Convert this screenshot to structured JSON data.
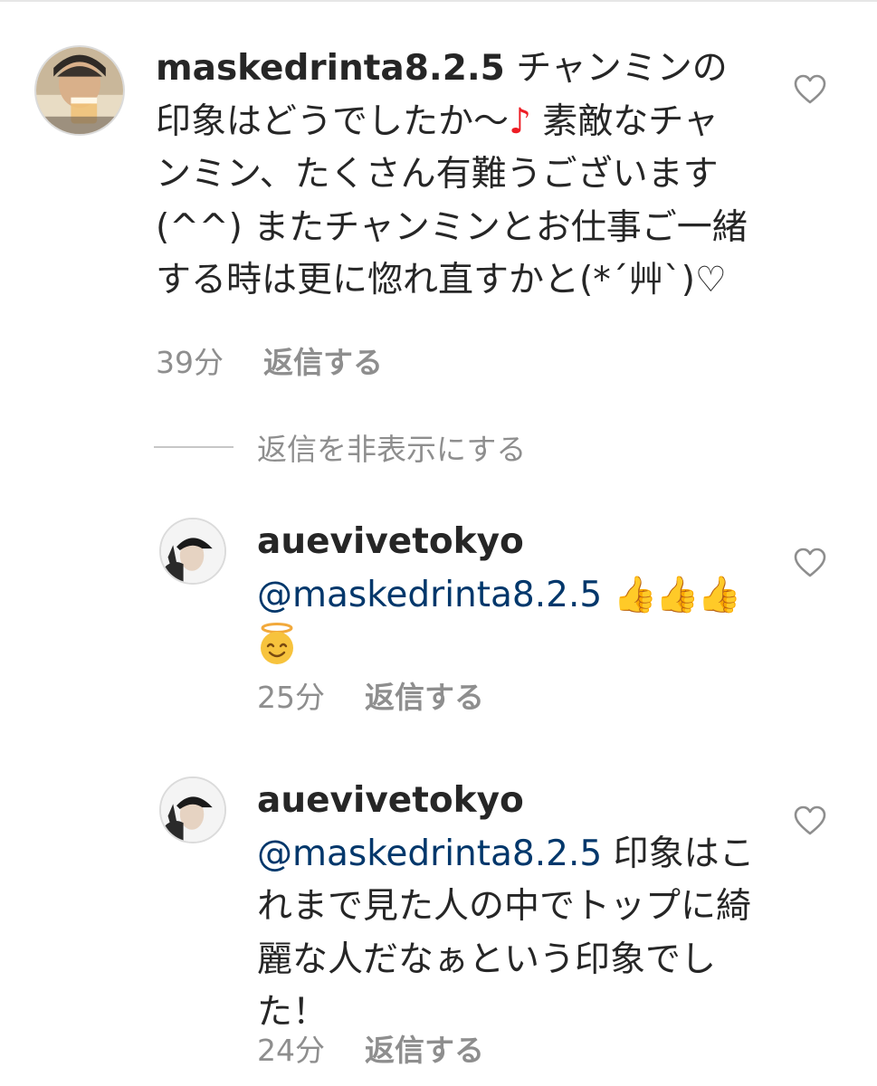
{
  "comments": [
    {
      "username": "maskedrinta8.2.5",
      "text_before_note": " チャンミンの印象はどうでしたか～",
      "note_glyph": "♪",
      "text_after_note": " 素敵なチャンミン、たくさん有難うございます(^^) またチャンミンとお仕事ご一緒する時は更に惚れ直すかと(*´艸`)♡",
      "time": "39分",
      "reply_label": "返信する",
      "avatar_icon": "user-avatar-photo",
      "like_icon": "heart-outline-icon"
    },
    {
      "username": "auevivetokyo",
      "mention": "@maskedrinta8.2.5",
      "emoji_text": "👍👍👍",
      "emoji_names": [
        "thumbs-up-icon",
        "thumbs-up-icon",
        "thumbs-up-icon",
        "smiling-face-with-halo-icon"
      ],
      "time": "25分",
      "reply_label": "返信する",
      "avatar_icon": "user-avatar-photo",
      "like_icon": "heart-outline-icon"
    },
    {
      "username": "auevivetokyo",
      "mention": "@maskedrinta8.2.5",
      "text": " 印象はこれまで見た人の中でトップに綺麗な人だなぁという印象でした！",
      "time": "24分",
      "reply_label": "返信する",
      "avatar_icon": "user-avatar-photo",
      "like_icon": "heart-outline-icon"
    }
  ],
  "hide_replies_label": "返信を非表示にする",
  "colors": {
    "text": "#262626",
    "muted": "#8e8e8e",
    "mention": "#00376b",
    "note": "#ed1c24",
    "emoji": "#f2a93b"
  }
}
